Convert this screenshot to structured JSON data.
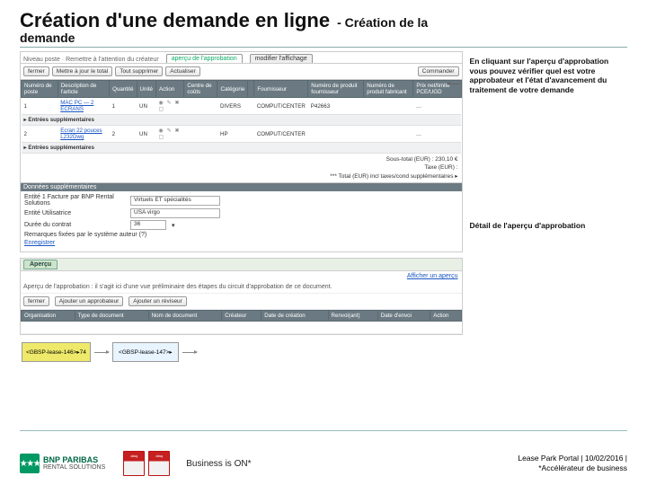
{
  "title": {
    "main": "Création d'une demande en ligne",
    "sub": "- Création de la",
    "line2": "demande"
  },
  "callouts": {
    "top": "En cliquant sur l'aperçu d'approbation vous pouvez vérifier quel est votre approbateur et l'état d'avancement du traitement de votre demande",
    "detail": "Détail de l'aperçu d'approbation"
  },
  "cart": {
    "crumb_prefix": "Niveau poste · Remettre à l'attention du créateur",
    "tab1": "aperçu de l'approbation",
    "tab2": "modifier l'affichage",
    "buttons": {
      "close": "fermer",
      "update": "Mettre à jour le total",
      "delete": "Tout supprimer",
      "refresh": "Actualiser",
      "order": "Commander"
    },
    "headers": [
      "Numéro de poste",
      "Description de l'article",
      "Quantité",
      "Unité",
      "Action",
      "Centre de coûts",
      "Catégorie",
      "",
      "Fournisseur",
      "Numéro de produit fournisseur",
      "Numéro de produit fabricant",
      "Prix net/limite PCE/UGD"
    ],
    "row1": {
      "num": "1",
      "desc": "MAC PC — 2 ECRANS",
      "qty": "1",
      "unit": "UN",
      "cat": "DIVERS",
      "supplier": "COMPUT/CENTER",
      "pnum": "P42663",
      "dots": "…"
    },
    "sub1": "▸ Entrées supplémentaires",
    "row2": {
      "num": "2",
      "desc": "Ecran 22 pouces L232Dwq",
      "qty": "2",
      "unit": "UN",
      "cat": "HP",
      "supplier": "COMPUT/CENTER",
      "dots": "…"
    },
    "sub2": "▸ Entrées supplémentaires",
    "totals": {
      "l1": "Sous-total (EUR) :  230,10 €",
      "l2": "Taxe (EUR) :",
      "l3": "*** Total (EUR) incl taxes/cond supplémentaires ▸"
    },
    "org": {
      "hdr": "Données supplémentaires",
      "row1_label": "Entité 1 Facture par BNP Rental Solutions",
      "row1_val": "Virtuels ET spécialités",
      "row2_label": "Entité Utilisatrice",
      "row2_val": "USA virgo",
      "row3_label": "Durée du contrat",
      "row3_val": "36",
      "row4_label": "Remarques fixées par le système auteur (?)",
      "row5_label": "Enregistrer"
    }
  },
  "approval": {
    "tab": "Aperçu",
    "preview": "Afficher un aperçu",
    "line": "Aperçu de l'approbation : il s'agit ici d'une vue préliminaire des étapes du circuit d'approbation de ce document.",
    "buttons": {
      "close": "fermer",
      "add_appr": "Ajouter un approbateur",
      "add_rev": "Ajouter un réviseur"
    },
    "headers": [
      "Organisation",
      "Type de document",
      "Nom de document",
      "Créateur",
      "Date de création",
      "Renvoi(ant)",
      "Date d'envoi",
      "Action"
    ]
  },
  "flow": {
    "box1": "<GBSP-lease-146>▸74",
    "box2": "<GBSP-lease-147>▸"
  },
  "footer": {
    "brand": "BNP PARIBAS",
    "brand_sub": "RENTAL SOLUTIONS",
    "afaq1": "afaq",
    "afaq2": "afaq",
    "tagline": "Business is ON*",
    "right1": "Lease Park Portal  |  10/02/2016  |",
    "right2": "*Accélérateur de business"
  }
}
